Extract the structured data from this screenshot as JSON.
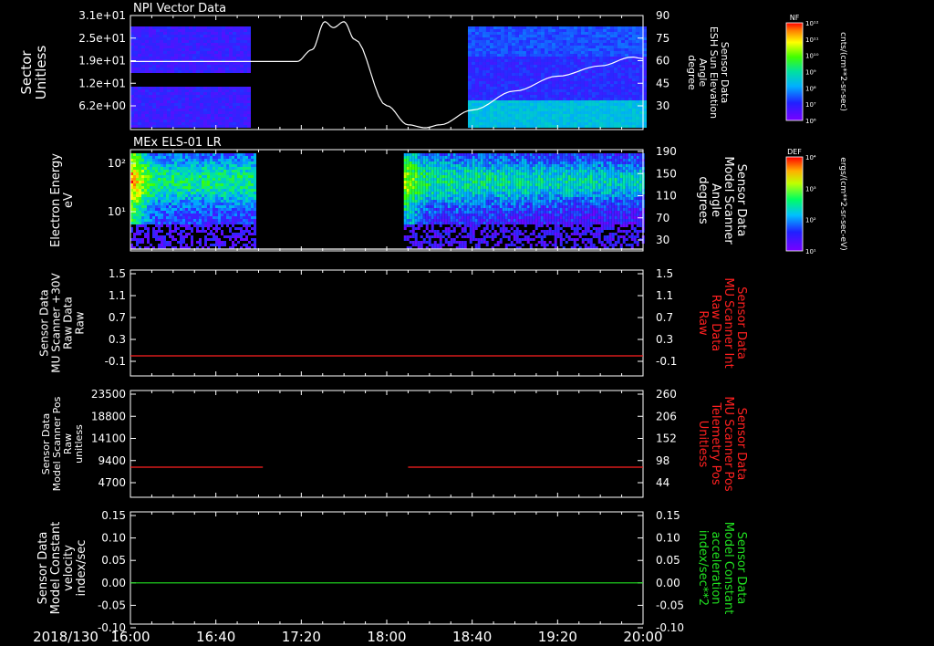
{
  "date_label": "2018/130",
  "time_ticks": [
    "16:00",
    "16:40",
    "17:20",
    "18:00",
    "18:40",
    "19:20",
    "20:00"
  ],
  "colors": {
    "white": "#ffffff",
    "red": "#ff2020",
    "green": "#20e020"
  },
  "colorbars": {
    "nf": {
      "title": "NF",
      "ticks": [
        "10¹²",
        "10¹¹",
        "10¹⁰",
        "10⁹",
        "10⁸",
        "10⁷",
        "10⁶"
      ],
      "unit": "cnts/(cm**2-sr-sec)"
    },
    "def": {
      "title": "DEF",
      "ticks": [
        "10⁴",
        "10³",
        "10²",
        "10¹"
      ],
      "unit": "ergs/(cm**2-sr-sec-eV)"
    }
  },
  "panels": [
    {
      "title": "NPI Vector Data",
      "left_label": [
        "Sector",
        "Unitless"
      ],
      "left_ticks": [
        "3.1e+01",
        "2.5e+01",
        "1.9e+01",
        "1.2e+01",
        "6.2e+00"
      ],
      "right_label": [
        "Sensor Data",
        "ESH Sun Elevation",
        "Angle",
        "degree"
      ],
      "right_ticks": [
        "90",
        "75",
        "60",
        "45",
        "30"
      ]
    },
    {
      "title": "MEx ELS-01 LR",
      "left_label": [
        "Electron Energy",
        "eV"
      ],
      "left_ticks": [
        "10²",
        "10¹"
      ],
      "right_label": [
        "Sensor Data",
        "Model Scanner",
        "Angle",
        "degrees"
      ],
      "right_ticks": [
        "190",
        "150",
        "110",
        "70",
        "30"
      ]
    },
    {
      "title": "",
      "left_label": [
        "Sensor Data",
        "MU Scanner +30V",
        "Raw Data",
        "Raw"
      ],
      "left_ticks": [
        "1.5",
        "1.1",
        "0.7",
        "0.3",
        "-0.1"
      ],
      "right_label": [
        "Sensor Data",
        "MU Scanner Int",
        "Raw Data",
        "Raw"
      ],
      "right_ticks": [
        "1.5",
        "1.1",
        "0.7",
        "0.3",
        "-0.1"
      ]
    },
    {
      "title": "",
      "left_label": [
        "Sensor Data",
        "Model Scanner Pos",
        "Raw",
        "unitless"
      ],
      "left_ticks": [
        "23500",
        "18800",
        "14100",
        "9400",
        "4700"
      ],
      "right_label": [
        "Sensor Data",
        "MU Scanner Pos",
        "Telemetry Pos",
        "Unitless"
      ],
      "right_ticks": [
        "260",
        "206",
        "152",
        "98",
        "44"
      ]
    },
    {
      "title": "",
      "left_label": [
        "Sensor Data",
        "Model Constant",
        "velocity",
        "index/sec"
      ],
      "left_ticks": [
        "0.15",
        "0.10",
        "0.05",
        "0.00",
        "-0.05",
        "-0.10"
      ],
      "right_label": [
        "Sensor Data",
        "Model Constant",
        "acceleration",
        "index/sec**2"
      ],
      "right_ticks": [
        "0.15",
        "0.10",
        "0.05",
        "0.00",
        "-0.05",
        "-0.10"
      ]
    }
  ],
  "chart_data": [
    {
      "type": "heatmap",
      "title": "NPI Vector Data",
      "ylabel": "Sector Unitless",
      "y2label": "Sensor Data ESH Sun Elevation Angle degree",
      "data_intervals": [
        [
          "16:00",
          "16:56"
        ],
        [
          "18:38",
          "20:00"
        ]
      ],
      "overlay_line": {
        "name": "ESH Sun Elevation Angle",
        "x": [
          "16:00",
          "17:00",
          "17:18",
          "17:25",
          "17:31",
          "17:35",
          "17:40",
          "17:45",
          "18:00",
          "18:10",
          "18:18",
          "18:25",
          "18:40",
          "19:00",
          "19:20",
          "19:40",
          "19:55",
          "20:00"
        ],
        "y": [
          60,
          60,
          60,
          68,
          87,
          83,
          87,
          75,
          30,
          17,
          15,
          17,
          27,
          40,
          50,
          57,
          63,
          62
        ],
        "ylim": [
          15,
          90
        ]
      }
    },
    {
      "type": "heatmap",
      "title": "MEx ELS-01 LR",
      "ylabel": "Electron Energy eV",
      "y2label": "Sensor Data Model Scanner Angle degrees",
      "data_intervals": [
        [
          "16:00",
          "16:58"
        ],
        [
          "18:08",
          "20:00"
        ]
      ],
      "overlay_line": {
        "name": "Model Scanner Angle",
        "x": [
          "16:00",
          "20:00"
        ],
        "y": [
          10,
          10
        ],
        "ylim": [
          10,
          190
        ]
      }
    },
    {
      "type": "line",
      "ylabel": "Sensor Data MU Scanner +30V Raw Data Raw",
      "y2label": "Sensor Data MU Scanner Int Raw Data Raw",
      "ylim": [
        -0.3,
        1.5
      ],
      "series": [
        {
          "x": [
            "16:00",
            "20:00"
          ],
          "values": [
            0.0,
            0.0
          ]
        }
      ]
    },
    {
      "type": "line",
      "ylabel": "Sensor Data Model Scanner Pos Raw unitless",
      "y2label": "Sensor Data MU Scanner Pos Telemetry Pos Unitless",
      "ylim": [
        0,
        23500
      ],
      "series": [
        {
          "x": [
            "16:00",
            "17:02"
          ],
          "values": [
            8000,
            8000
          ]
        },
        {
          "x": [
            "18:10",
            "20:00"
          ],
          "values": [
            8000,
            8000
          ]
        }
      ]
    },
    {
      "type": "line",
      "ylabel": "Sensor Data Model Constant velocity index/sec",
      "y2label": "Sensor Data Model Constant acceleration index/sec**2",
      "ylim": [
        -0.1,
        0.15
      ],
      "series": [
        {
          "x": [
            "16:00",
            "20:00"
          ],
          "values": [
            0.0,
            0.0
          ]
        }
      ]
    }
  ]
}
